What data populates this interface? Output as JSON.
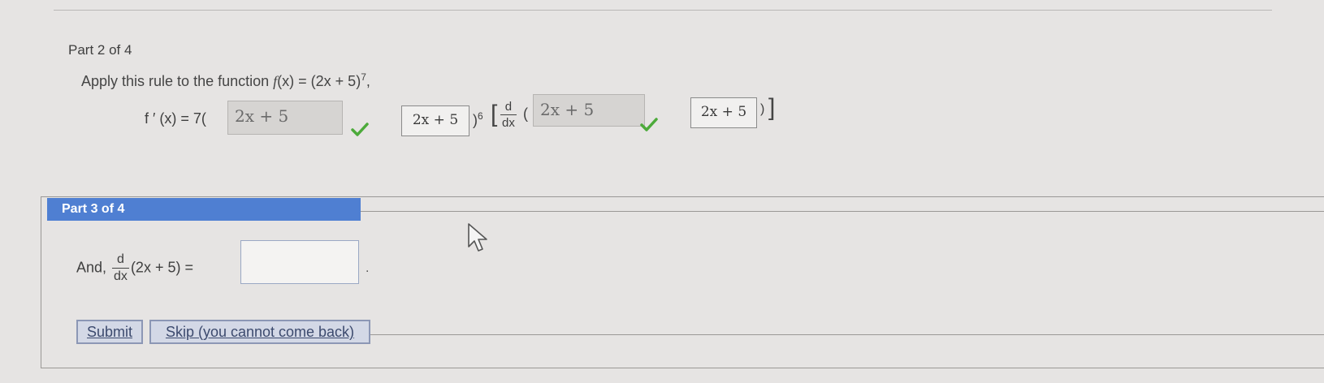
{
  "part2": {
    "heading": "Part 2 of 4",
    "instruction_prefix": "Apply this rule to the function ",
    "function_name": "f",
    "function_arg": "(x) = (2x + 5)",
    "exponent": "7",
    "instruction_suffix": ",",
    "derivative": {
      "lhs": "f ′ (x) = 7(",
      "answer1": "2x + 5",
      "display1": "2x + 5",
      "close_power": ")",
      "power": "6",
      "frac_num": "d",
      "frac_den": "dx",
      "open_paren": "(",
      "answer2": "2x + 5",
      "display2": "2x + 5",
      "close_paren": ")"
    },
    "check_color": "#4caa3a"
  },
  "part3": {
    "heading": "Part 3 of 4",
    "header_color": "#4f7fd2",
    "question_prefix": "And, ",
    "frac_num": "d",
    "frac_den": "dx",
    "question_expr": "(2x + 5) =",
    "answer_value": "",
    "period": "."
  },
  "buttons": {
    "submit": "Submit",
    "skip": "Skip (you cannot come back)"
  }
}
